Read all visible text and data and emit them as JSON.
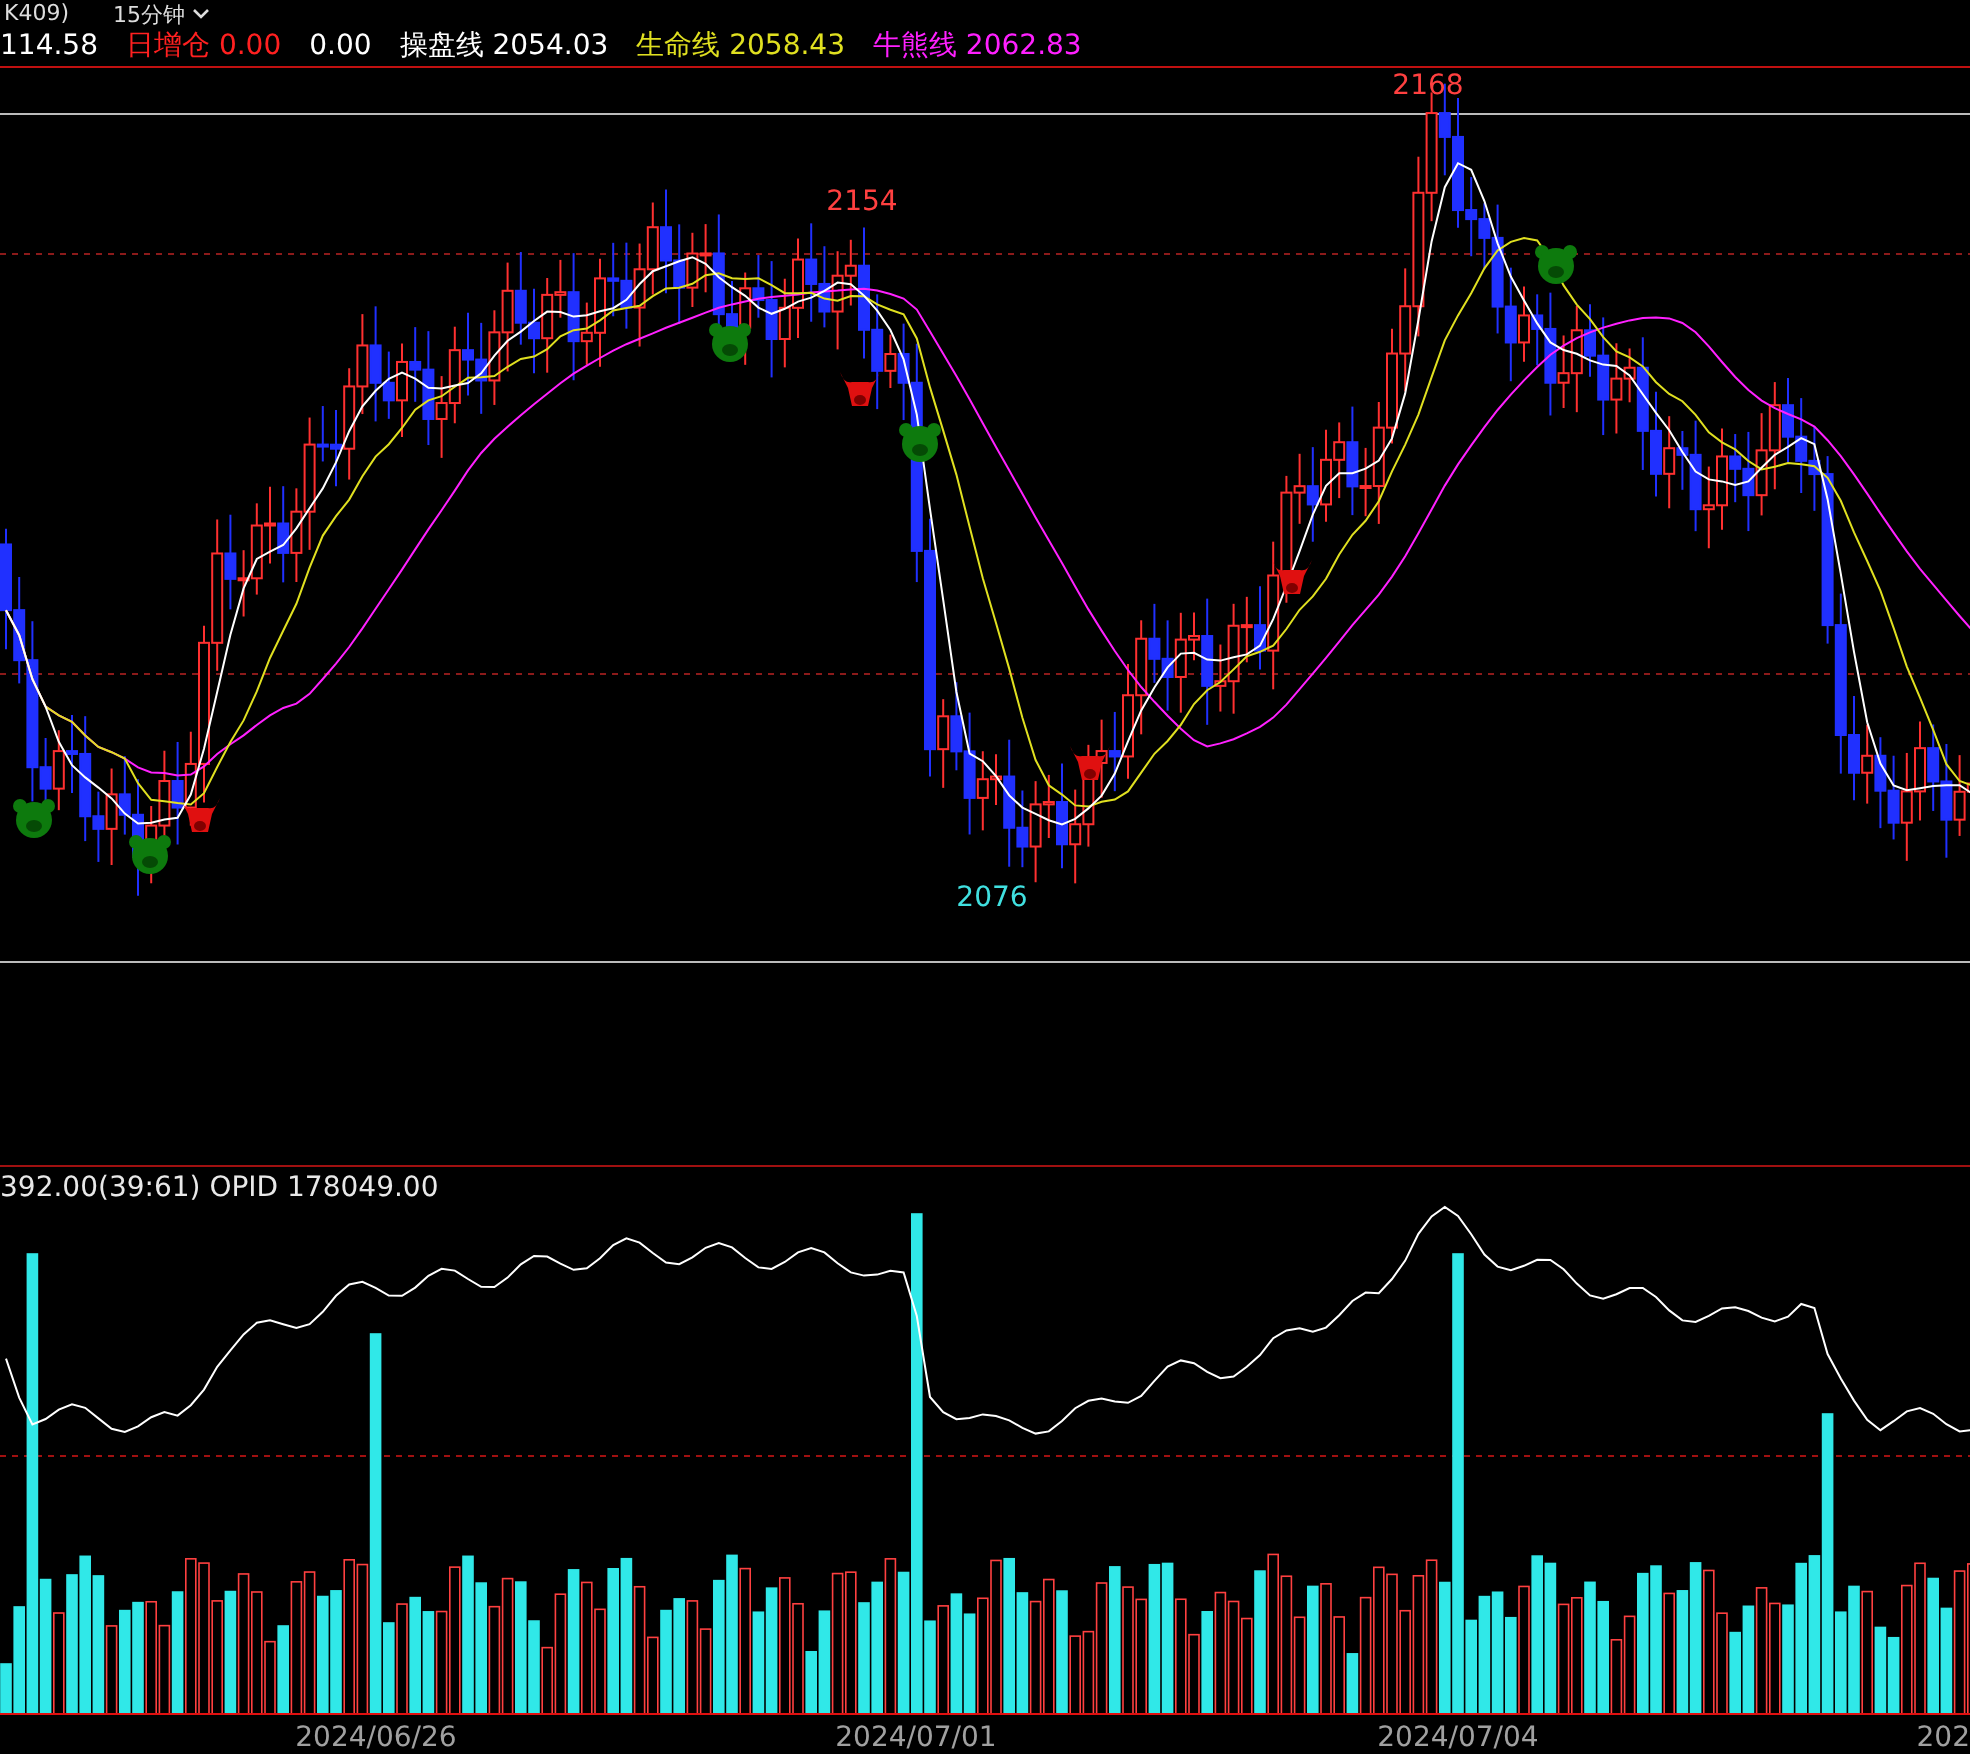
{
  "title_bar": {
    "symbol": "K409)",
    "period": "15分钟"
  },
  "header": {
    "items": [
      {
        "value": "114.58",
        "color": "#ffffff"
      },
      {
        "label": "日增仓",
        "value": "0.00",
        "color": "#ff2020"
      },
      {
        "value": "0.00",
        "color": "#ffffff"
      },
      {
        "label": "操盘线",
        "value": "2054.03",
        "color": "#ffffff"
      },
      {
        "label": "生命线",
        "value": "2058.43",
        "color": "#e0e020"
      },
      {
        "label": "牛熊线",
        "value": "2062.83",
        "color": "#ff20ff"
      }
    ]
  },
  "price_labels": [
    {
      "text": "2168",
      "color": "#ff4040"
    },
    {
      "text": "2154",
      "color": "#ff4040"
    },
    {
      "text": "2076",
      "color": "#40e0e0"
    }
  ],
  "indicator": {
    "items": [
      "392.00(39:61)",
      "OPID 178049.00"
    ]
  },
  "x_axis": {
    "labels": [
      "2024/06/26",
      "2024/07/01",
      "2024/07/04",
      "202"
    ]
  }
}
